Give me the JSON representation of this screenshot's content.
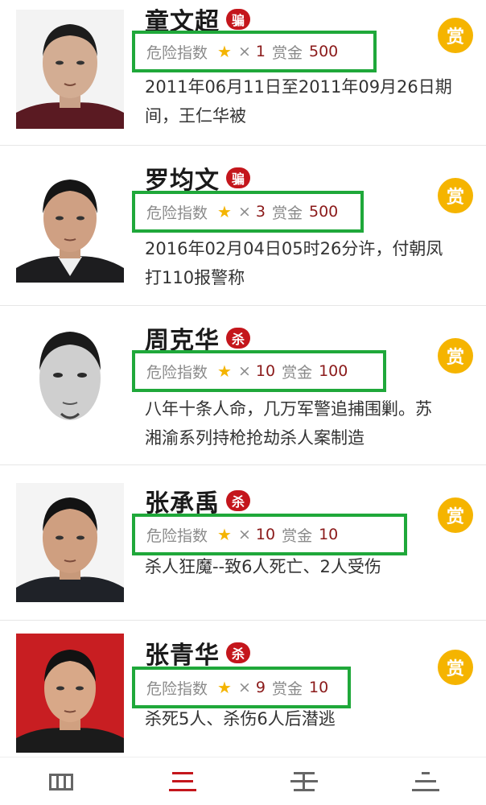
{
  "labels": {
    "danger_index": "危险指数",
    "times": "×",
    "reward": "赏金",
    "reward_icon": "赏"
  },
  "colors": {
    "highlight": "#1fa83a",
    "badge": "#c4161c",
    "star": "#f4b400",
    "reward_icon": "#f5b400",
    "tab_active": "#c4161c",
    "tab_inactive": "#666666"
  },
  "items": [
    {
      "name": "童文超",
      "badge": "骗",
      "stars": "1",
      "reward": "500",
      "desc_line1": "2011年06月11日至2011年09月26日期",
      "desc_line2": "间，王仁华被"
    },
    {
      "name": "罗均文",
      "badge": "骗",
      "stars": "3",
      "reward": "500",
      "desc_line1": "2016年02月04日05时26分许，付朝凤",
      "desc_line2": "打110报警称"
    },
    {
      "name": "周克华",
      "badge": "杀",
      "stars": "10",
      "reward": "100",
      "desc_line1": "八年十条人命，几万军警追捕围剿。苏",
      "desc_line2": "湘渝系列持枪抢劫杀人案制造"
    },
    {
      "name": "张承禹",
      "badge": "杀",
      "stars": "10",
      "reward": "10",
      "desc_line1": "杀人狂魔--致6人死亡、2人受伤",
      "desc_line2": ""
    },
    {
      "name": "张青华",
      "badge": "杀",
      "stars": "9",
      "reward": "10",
      "desc_line1": "杀死5人、杀伤6人后潜逃",
      "desc_line2": ""
    }
  ],
  "tabbar": {
    "tabs": [
      {
        "icon": "grid-icon",
        "active": false
      },
      {
        "icon": "list-icon",
        "active": true
      },
      {
        "icon": "split-icon",
        "active": false
      },
      {
        "icon": "menu-icon",
        "active": false
      }
    ]
  }
}
